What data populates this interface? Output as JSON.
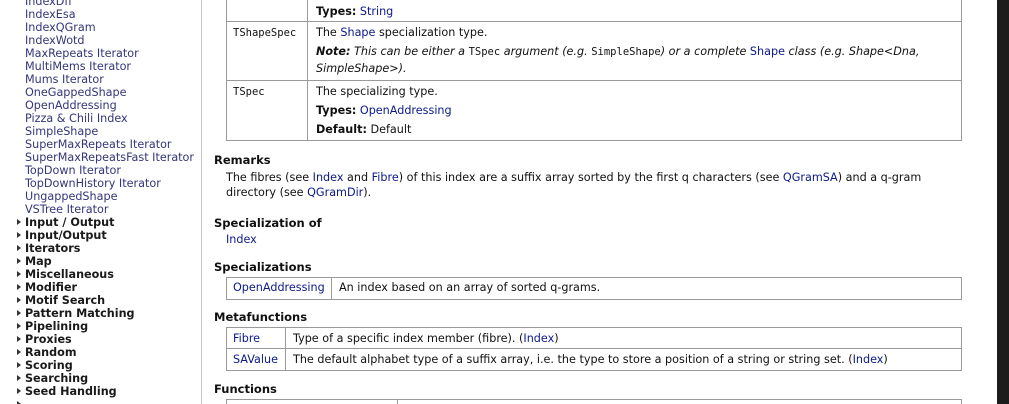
{
  "sidebar": {
    "items": [
      "IndexDfi",
      "IndexEsa",
      "IndexQGram",
      "IndexWotd",
      "MaxRepeats Iterator",
      "MultiMems Iterator",
      "Mums Iterator",
      "OneGappedShape",
      "OpenAddressing",
      "Pizza & Chili Index",
      "SimpleShape",
      "SuperMaxRepeats Iterator",
      "SuperMaxRepeatsFast Iterator",
      "TopDown Iterator",
      "TopDownHistory Iterator",
      "UngappedShape",
      "VSTree Iterator"
    ],
    "categories": [
      "Input / Output",
      "Input/Output",
      "Iterators",
      "Map",
      "Miscellaneous",
      "Modifier",
      "Motif Search",
      "Pattern Matching",
      "Pipelining",
      "Proxies",
      "Random",
      "Scoring",
      "Searching",
      "Seed Handling"
    ]
  },
  "params": {
    "row0": {
      "types_label": "Types:",
      "types_value": "String"
    },
    "row1": {
      "name": "TShapeSpec",
      "desc_a": "The ",
      "desc_link": "Shape",
      "desc_b": " specialization type.",
      "note_label": "Note:",
      "note_a": " This can be either a ",
      "note_code": "TSpec",
      "note_b": " argument (e.g. ",
      "note_code2": "SimpleShape",
      "note_c": ") or a complete ",
      "note_link": "Shape",
      "note_d": " class (e.g. Shape<Dna,",
      "note_line2": "SimpleShape>)."
    },
    "row2": {
      "name": "TSpec",
      "desc": "The specializing type.",
      "types_label": "Types:",
      "types_value": "OpenAddressing",
      "default_label": "Default:",
      "default_value": "Default"
    }
  },
  "remarks": {
    "heading": "Remarks",
    "t1": "The fibres (see ",
    "l1": "Index",
    "t2": " and ",
    "l2": "Fibre",
    "t3": ") of this index are a suffix array sorted by the first q characters (see ",
    "l3": "QGramSA",
    "t4": ") and a q-gram",
    "t5": "directory (see ",
    "l4": "QGramDir",
    "t6": ")."
  },
  "specialization_of": {
    "heading": "Specialization of",
    "link": "Index"
  },
  "specializations": {
    "heading": "Specializations",
    "rows": [
      {
        "name": "OpenAddressing",
        "desc": "An index based on an array of sorted q-grams."
      }
    ]
  },
  "metafunctions": {
    "heading": "Metafunctions",
    "rows": [
      {
        "name": "Fibre",
        "desc": "Type of a specific index member (fibre). (",
        "link": "Index",
        "end": ")"
      },
      {
        "name": "SAValue",
        "desc": "The default alphabet type of a suffix array, i.e. the type to store a position of a string or string set. (",
        "link": "Index",
        "end": ")"
      }
    ]
  },
  "functions": {
    "heading": "Functions"
  },
  "colors": {
    "link": "#0b1a8a",
    "sidebar_link": "#35357a",
    "border": "#9a9a9a"
  }
}
